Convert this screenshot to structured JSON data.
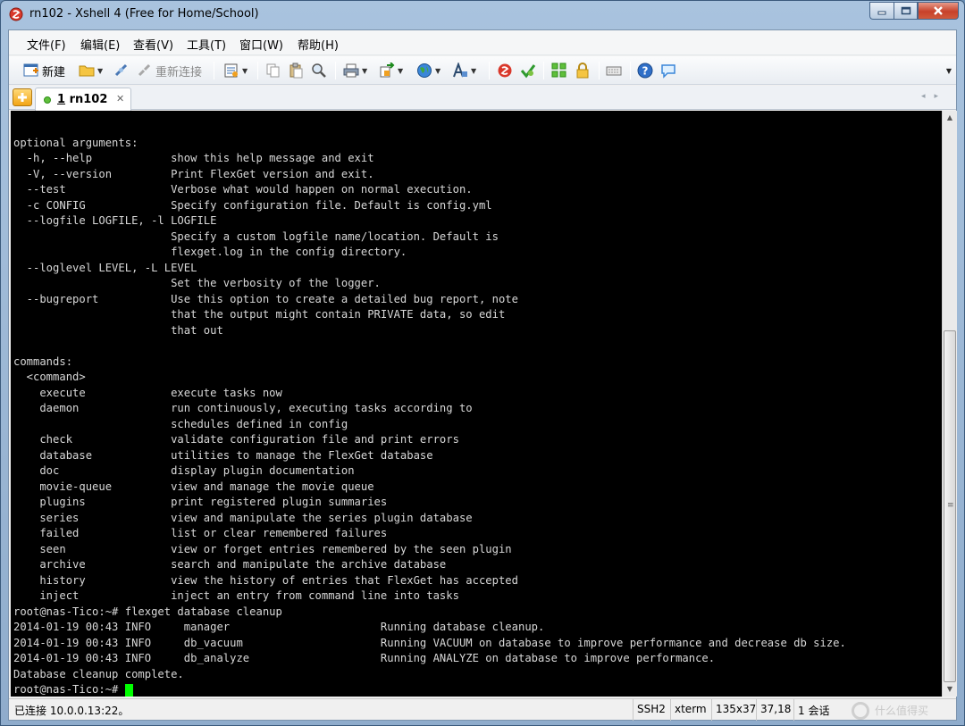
{
  "window": {
    "title": "rn102 - Xshell 4 (Free for Home/School)"
  },
  "menu": [
    "文件(F)",
    "编辑(E)",
    "查看(V)",
    "工具(T)",
    "窗口(W)",
    "帮助(H)"
  ],
  "toolbar": {
    "new_label": "新建",
    "reconnect_label": "重新连接"
  },
  "tabs": [
    {
      "number": "1",
      "label": "rn102"
    }
  ],
  "terminal": {
    "lines": [
      "",
      "optional arguments:",
      "  -h, --help            show this help message and exit",
      "  -V, --version         Print FlexGet version and exit.",
      "  --test                Verbose what would happen on normal execution.",
      "  -c CONFIG             Specify configuration file. Default is config.yml",
      "  --logfile LOGFILE, -l LOGFILE",
      "                        Specify a custom logfile name/location. Default is",
      "                        flexget.log in the config directory.",
      "  --loglevel LEVEL, -L LEVEL",
      "                        Set the verbosity of the logger.",
      "  --bugreport           Use this option to create a detailed bug report, note",
      "                        that the output might contain PRIVATE data, so edit",
      "                        that out",
      "",
      "commands:",
      "  <command>",
      "    execute             execute tasks now",
      "    daemon              run continuously, executing tasks according to",
      "                        schedules defined in config",
      "    check               validate configuration file and print errors",
      "    database            utilities to manage the FlexGet database",
      "    doc                 display plugin documentation",
      "    movie-queue         view and manage the movie queue",
      "    plugins             print registered plugin summaries",
      "    series              view and manipulate the series plugin database",
      "    failed              list or clear remembered failures",
      "    seen                view or forget entries remembered by the seen plugin",
      "    archive             search and manipulate the archive database",
      "    history             view the history of entries that FlexGet has accepted",
      "    inject              inject an entry from command line into tasks",
      "root@nas-Tico:~# flexget database cleanup",
      "2014-01-19 00:43 INFO     manager                       Running database cleanup.",
      "2014-01-19 00:43 INFO     db_vacuum                     Running VACUUM on database to improve performance and decrease db size.",
      "2014-01-19 00:43 INFO     db_analyze                    Running ANALYZE on database to improve performance.",
      "Database cleanup complete.",
      "root@nas-Tico:~# "
    ]
  },
  "status": {
    "connection": "已连接 10.0.0.13:22。",
    "protocol": "SSH2",
    "term_type": "xterm",
    "size": "135x37",
    "cursor_pos": "37,18",
    "sessions": "1 会话"
  },
  "watermark": "什么值得买",
  "colors": {
    "terminal_bg": "#000000",
    "terminal_fg": "#d8d8d8",
    "cursor": "#00ff00"
  }
}
